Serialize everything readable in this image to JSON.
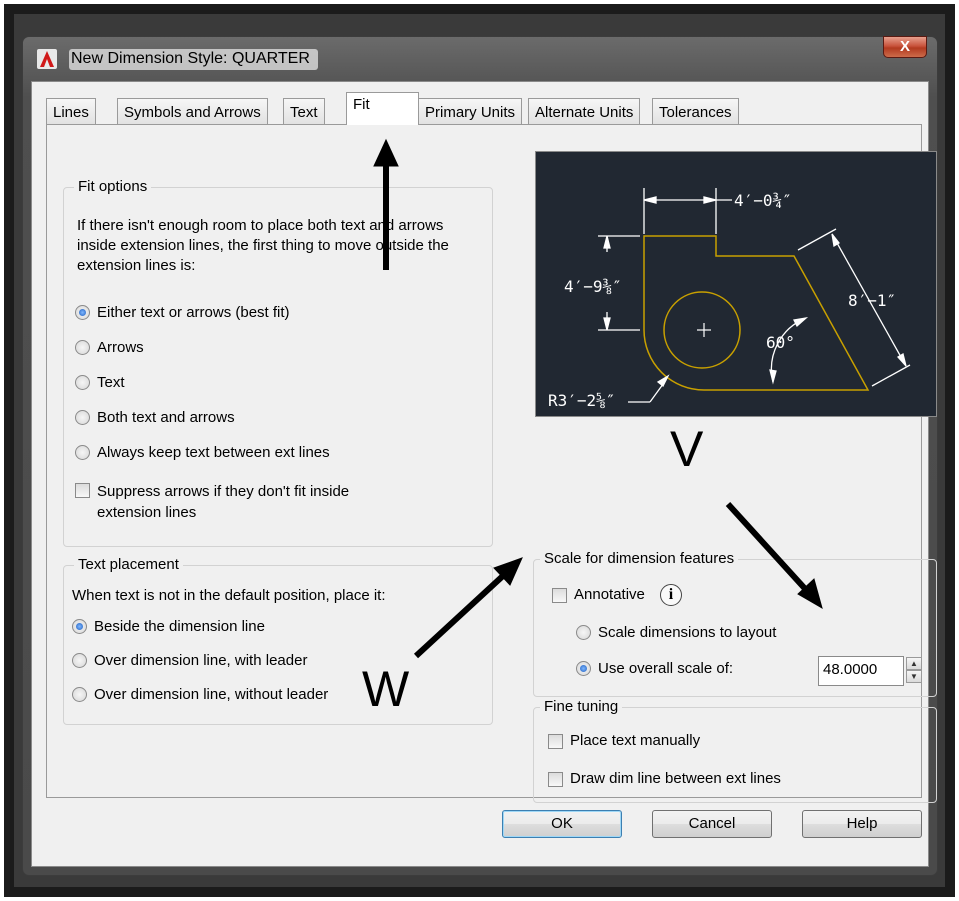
{
  "window": {
    "title": "New Dimension Style: QUARTER",
    "close_label": "X"
  },
  "tabs": [
    {
      "label": "Lines"
    },
    {
      "label": "Symbols and Arrows"
    },
    {
      "label": "Text"
    },
    {
      "label": "Fit"
    },
    {
      "label": "Primary Units"
    },
    {
      "label": "Alternate Units"
    },
    {
      "label": "Tolerances"
    }
  ],
  "active_tab": "Fit",
  "fit_options": {
    "title": "Fit options",
    "description": "If there isn't enough room to place both text and arrows inside extension lines, the first thing to move outside the extension lines is:",
    "options": [
      {
        "label": "Either text or arrows (best fit)",
        "checked": true
      },
      {
        "label": "Arrows",
        "checked": false
      },
      {
        "label": "Text",
        "checked": false
      },
      {
        "label": "Both text and arrows",
        "checked": false
      },
      {
        "label": "Always keep text between ext lines",
        "checked": false
      }
    ],
    "suppress_label": "Suppress arrows if they don't fit inside extension lines",
    "suppress_checked": false
  },
  "text_placement": {
    "title": "Text placement",
    "description": "When text is not in the default position, place it:",
    "options": [
      {
        "label": "Beside the dimension line",
        "checked": true
      },
      {
        "label": "Over dimension line, with leader",
        "checked": false
      },
      {
        "label": "Over dimension line, without leader",
        "checked": false
      }
    ]
  },
  "preview": {
    "top_dim": "4′−0¾″",
    "left_dim": "4′−9⅜″",
    "right_dim": "8′−1″",
    "angle": "60°",
    "radius": "R3′−2⅝″",
    "colors": {
      "background": "#212832",
      "geometry": "#c8a000",
      "dims": "#ffffff"
    }
  },
  "scale": {
    "title": "Scale for dimension features",
    "annotative_label": "Annotative",
    "annotative_checked": false,
    "info_icon": "i",
    "layout_label": "Scale dimensions to layout",
    "layout_checked": false,
    "overall_label": "Use overall scale of:",
    "overall_checked": true,
    "overall_value": "48.0000"
  },
  "fine_tuning": {
    "title": "Fine tuning",
    "place_manual_label": "Place text manually",
    "place_manual_checked": false,
    "draw_dim_label": "Draw dim line between ext lines",
    "draw_dim_checked": false
  },
  "buttons": {
    "ok": "OK",
    "cancel": "Cancel",
    "help": "Help"
  },
  "annotations": {
    "letter_v": "V",
    "letter_w": "W"
  }
}
